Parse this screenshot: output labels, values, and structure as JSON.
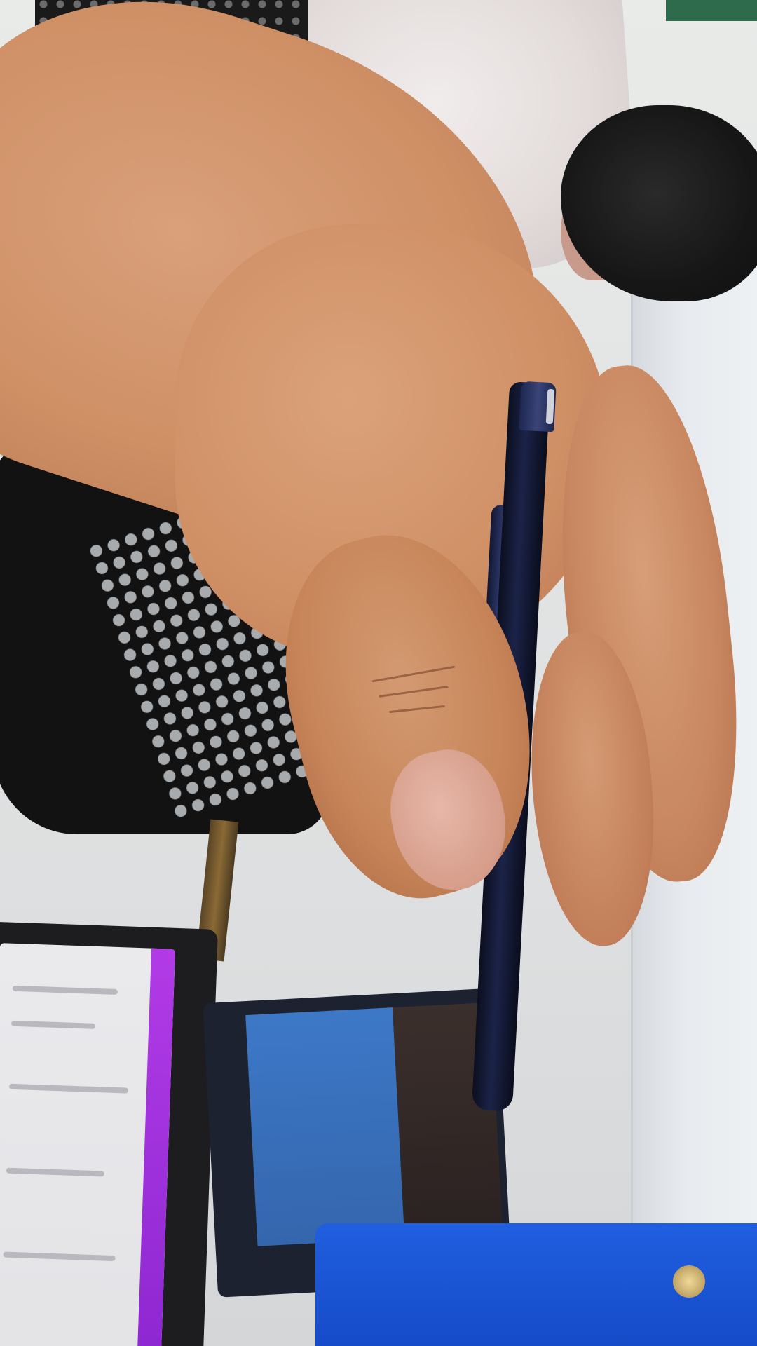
{
  "scene": {
    "description_colors": {
      "skin": "#cf9066",
      "pen": "#1b2348",
      "folder": "#1f5fe0",
      "chair_mesh": "#121213",
      "laptop_accent": "#b23be6"
    }
  }
}
